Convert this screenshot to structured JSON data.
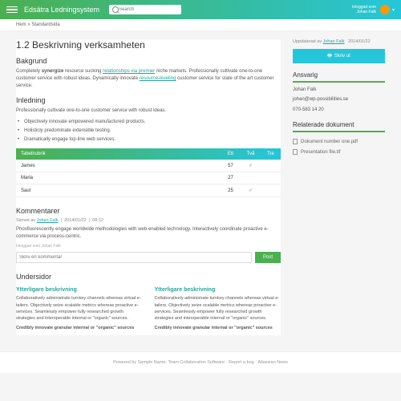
{
  "header": {
    "brand": "Edsätra Ledningsystem",
    "search_placeholder": "Search",
    "logged_label": "Inloggad som",
    "user": "Johan Falk"
  },
  "crumbs": {
    "home": "Hem",
    "sep": "»",
    "cur": "Standardsida"
  },
  "page": {
    "title": "1.2 Beskrivning verksamheten",
    "bakgrund": {
      "h": "Bakgrund",
      "p": "Completely synergize resource sucking relationships via premier niche markets. Professionally cultivate one-to-one customer service with robust ideas. Dynamically innovate resource-leveling customer service for state of the art customer service."
    },
    "inledning": {
      "h": "Inledning",
      "p": "Professionally cultivate one-to-one customer service with robust ideas.",
      "items": [
        "Objectively innovate empowered manufactured products.",
        "Holisticly predominate extensible testing.",
        "Dramatically engage top-line web services."
      ]
    },
    "table": {
      "h": "Tabellrubrik",
      "cols": [
        "Ett",
        "Två",
        "Tre"
      ],
      "rows": [
        {
          "n": "James",
          "a": "57",
          "b": "✓",
          "c": ""
        },
        {
          "n": "Maria",
          "a": "27",
          "b": "",
          "c": ""
        },
        {
          "n": "Saul",
          "a": "25",
          "b": "✓",
          "c": ""
        }
      ]
    },
    "comments": {
      "h": "Kommentarer",
      "by": "Skrivet av",
      "author": "Johan Falk",
      "date": "2014/01/22",
      "time": "08:12",
      "body": "Phosfluorescently engage worldwide methodologies with web-enabled technology. Interactively coordinate proactive e-commerce via process-centric.",
      "hint": "Inloggad som Johan Falk",
      "placeholder": "Skriv en kommentar",
      "post": "Post"
    },
    "subs": {
      "h": "Undersidor",
      "items": [
        {
          "t": "Ytterligare beskrivning",
          "p": "Collaboratively administrate turnkey channels whereas virtual e-tailers. Objectively seize scalable metrics whereas proactive e-services. Seamlessly empower fully researched growth strategies and interoperable internal or \"organic\" sources.",
          "b": "Credibly innovate granular internal or \"organic\" sources"
        },
        {
          "t": "Ytterligare beskrivning",
          "p": "Collaboratively administrate turnkey channels whereas virtual e-tailers. Objectively seize scalable metrics whereas proactive e-services. Seamlessly empower fully researched growth strategies and interoperable internal or \"organic\" sources.",
          "b": "Credibly innovate granular internal or \"organic\" sources"
        }
      ]
    }
  },
  "side": {
    "upd_by": "Uppdaterad av",
    "upd_auth": "Johan Falk",
    "upd_date": "2014/01/22",
    "print": "Skriv ut",
    "ansvarig": {
      "h": "Ansvarig",
      "name": "Johan Falk",
      "email": "johan@wp-possibilities.se",
      "phone": "070-583 14 20"
    },
    "docs": {
      "h": "Relaterade dokument",
      "items": [
        "Dokument number one.pdf",
        "Presentation file.tif"
      ]
    }
  },
  "footer": "Powered by Sample Name, Team Collaboration Software · Report a bug · Atlassian News"
}
